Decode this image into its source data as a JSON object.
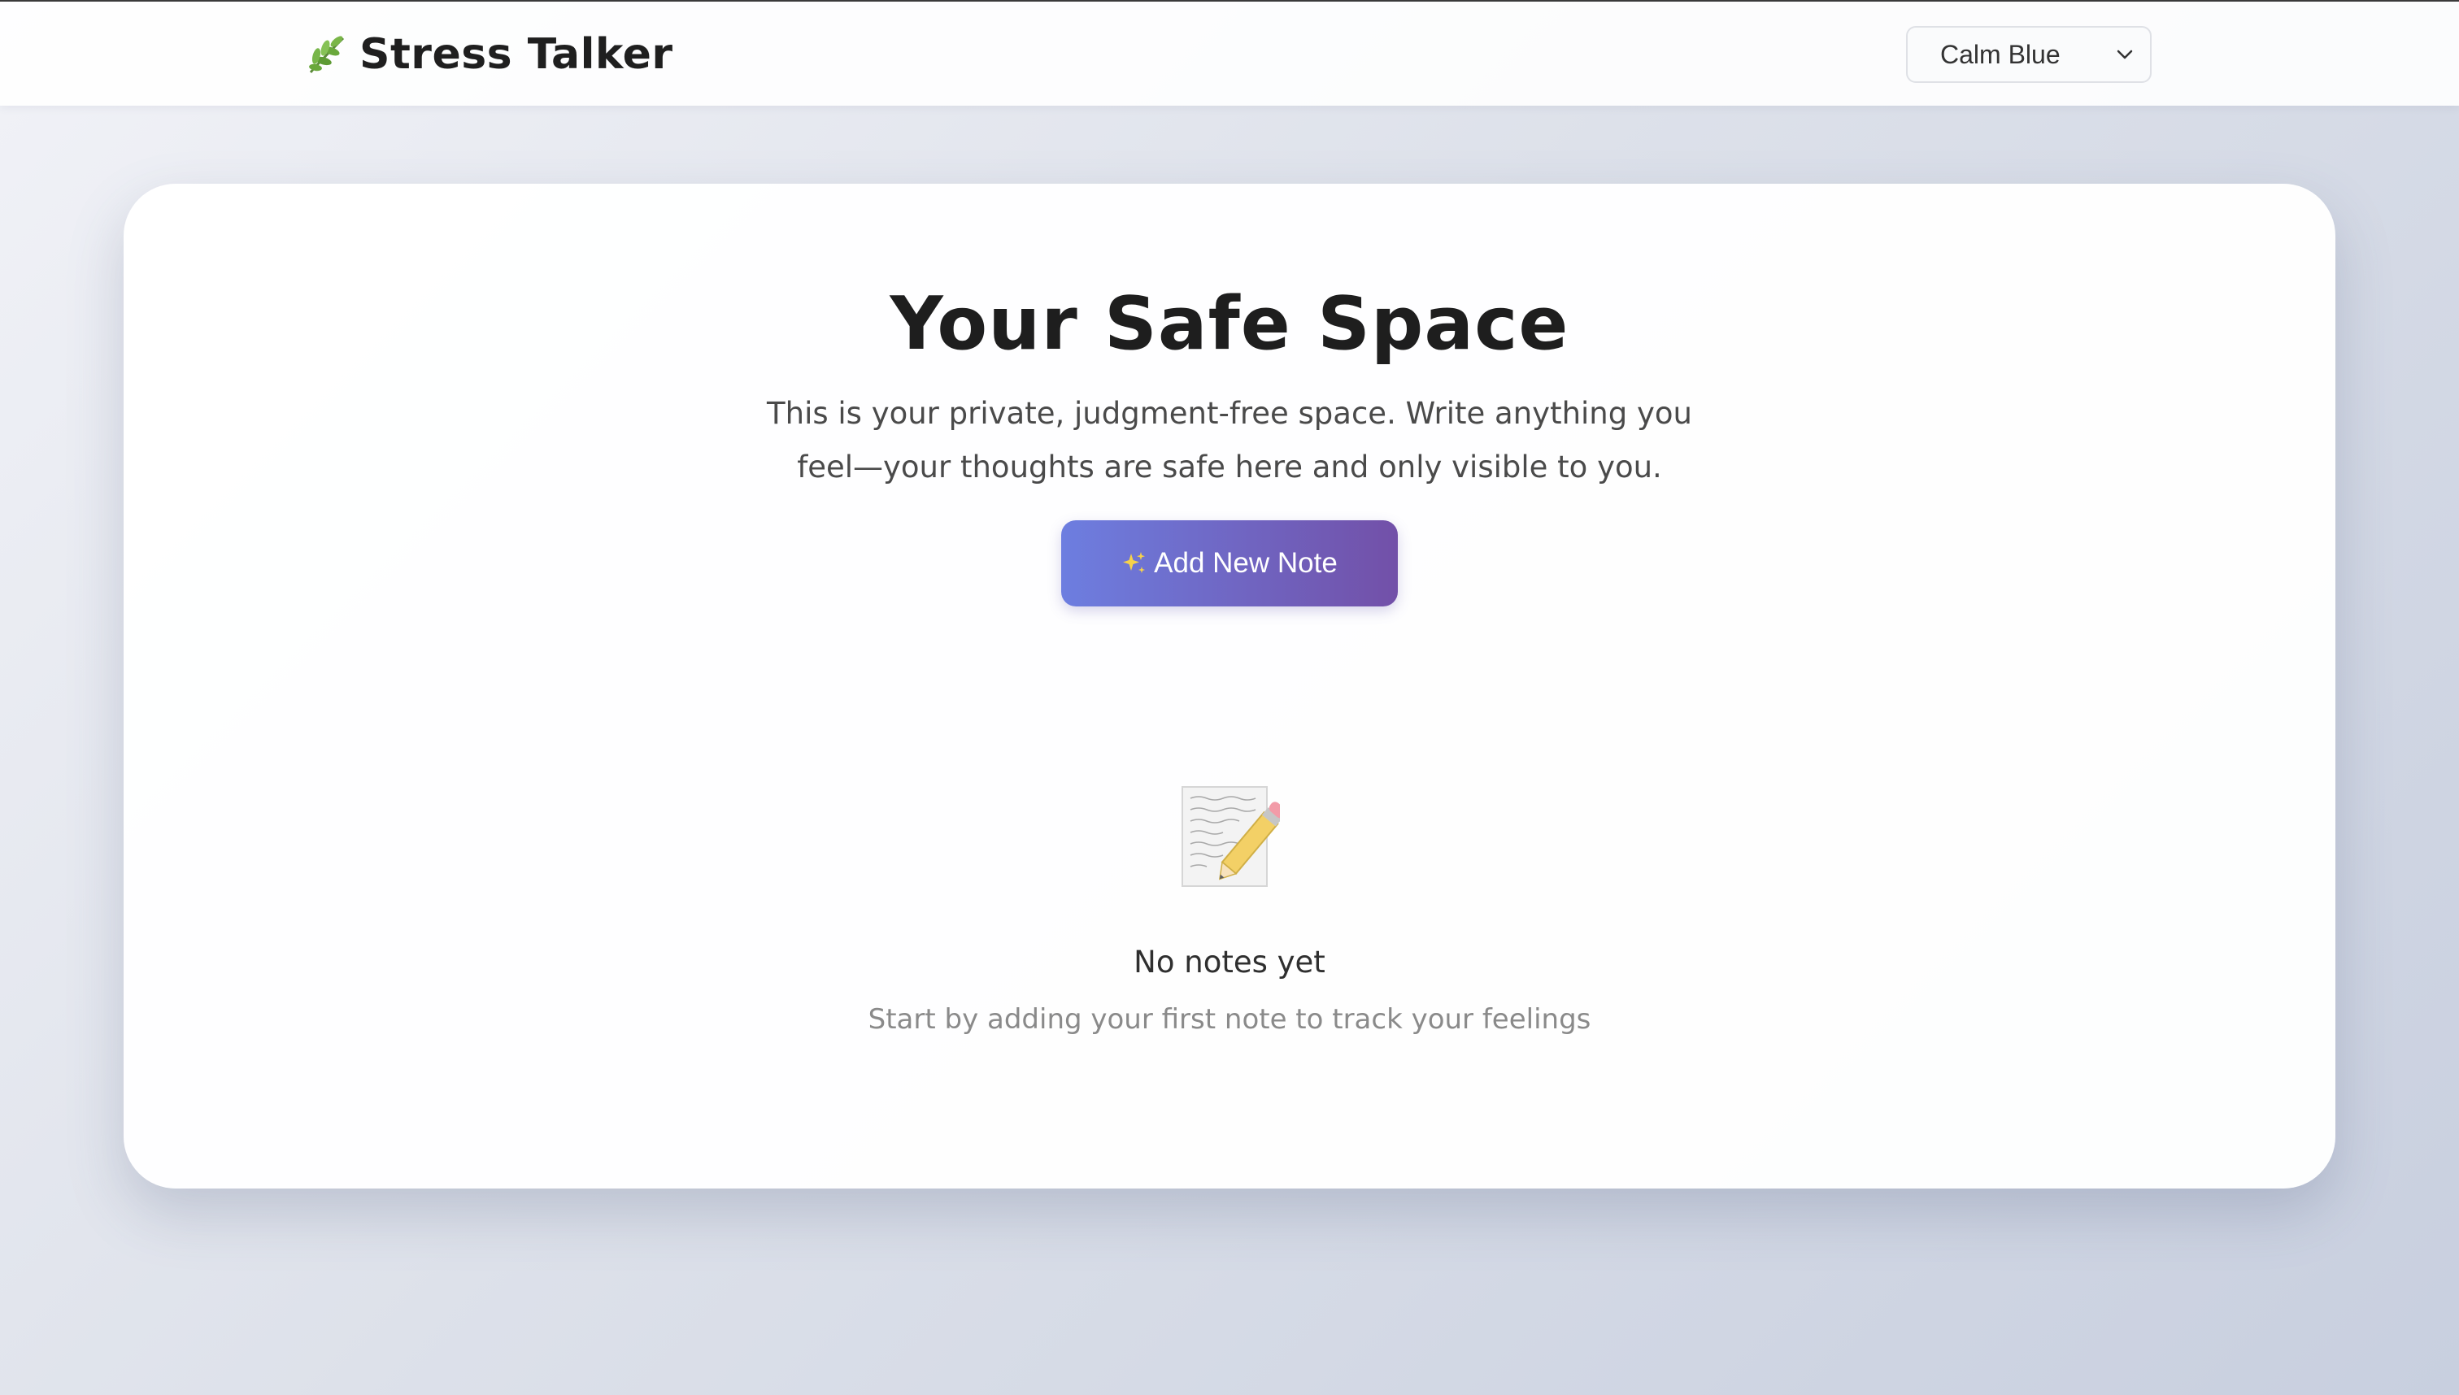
{
  "app": {
    "title": "Stress Talker",
    "logo_icon": "herb-leaf-icon"
  },
  "header": {
    "theme_select": {
      "selected": "Calm Blue",
      "icon": "chevron-down-icon"
    }
  },
  "main": {
    "title": "Your Safe Space",
    "description": "This is your private, judgment-free space. Write anything you feel—your thoughts are safe here and only visible to you.",
    "add_note_button": {
      "label": "Add New Note",
      "icon": "sparkles-icon"
    },
    "empty_state": {
      "icon": "memo-pencil-icon",
      "title": "No notes yet",
      "subtitle": "Start by adding your first note to track your feelings"
    }
  },
  "colors": {
    "button_gradient_start": "#6d7ee0",
    "button_gradient_end": "#7250a8",
    "background_start": "#f1f2f7",
    "background_end": "#c8cfdf"
  }
}
